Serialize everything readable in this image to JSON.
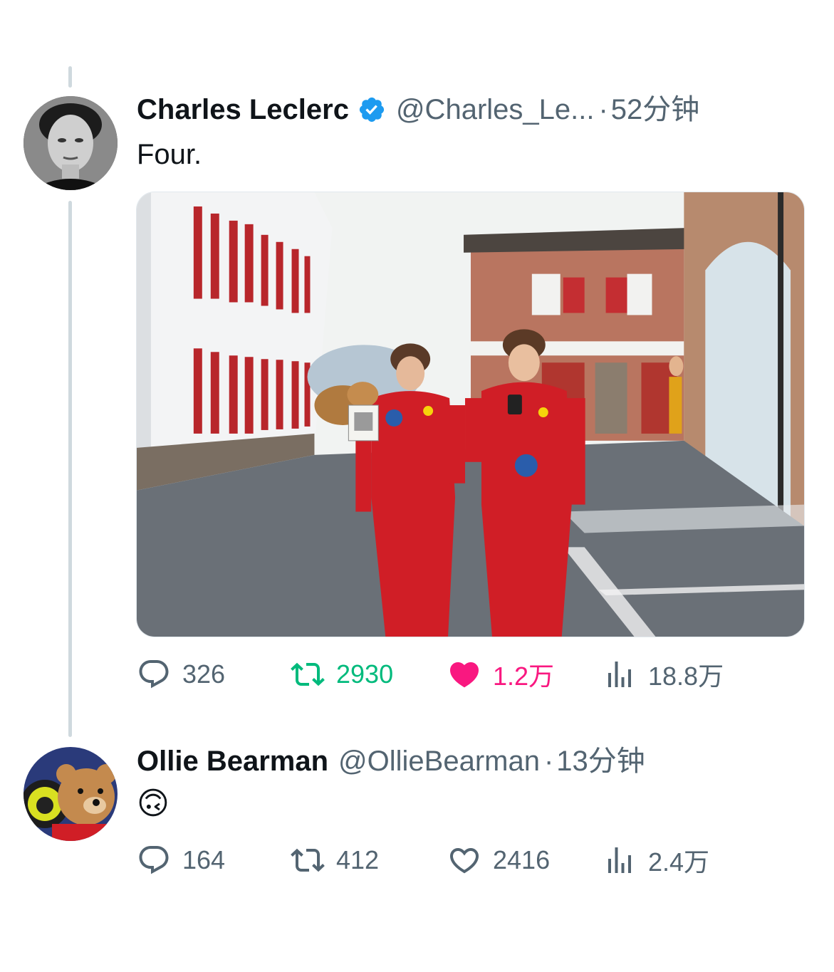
{
  "tweets": [
    {
      "author_name": "Charles Leclerc",
      "verified": true,
      "handle": "@Charles_Le...",
      "separator": "·",
      "time": "52分钟",
      "text": "Four.",
      "has_media": true,
      "stats": {
        "replies": "326",
        "retweets": "2930",
        "likes": "1.2万",
        "views": "18.8万"
      },
      "state": {
        "retweeted": true,
        "liked": true
      }
    },
    {
      "author_name": "Ollie Bearman",
      "verified": false,
      "handle": "@OllieBearman",
      "separator": "·",
      "time": "13分钟",
      "text": "🙃",
      "has_media": false,
      "stats": {
        "replies": "164",
        "retweets": "412",
        "likes": "2416",
        "views": "2.4万"
      },
      "state": {
        "retweeted": false,
        "liked": false
      }
    }
  ],
  "colors": {
    "verified_blue": "#1d9bf0",
    "retweet_green": "#00ba7c",
    "like_pink": "#f91880",
    "secondary_text": "#536471",
    "thread_line": "#cfd9de"
  },
  "icons": [
    "verified-badge-icon",
    "reply-icon",
    "retweet-icon",
    "like-icon",
    "views-icon"
  ]
}
